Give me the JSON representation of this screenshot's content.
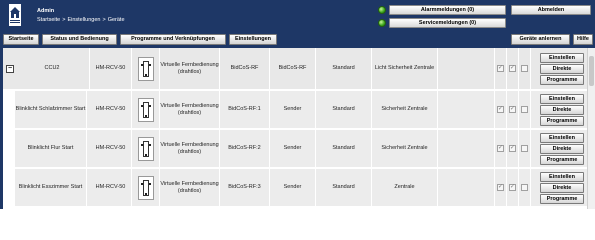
{
  "header": {
    "user": "Admin",
    "breadcrumb": [
      "Startseite",
      "Einstellungen",
      "Geräte"
    ],
    "breadcrumb_sep": ">",
    "alarm_button": "Alarmmeldungen (0)",
    "service_button": "Servicemeldungen (0)",
    "logout_button": "Abmelden"
  },
  "nav": {
    "home": "Startseite",
    "status": "Status und Bedienung",
    "programs": "Programme und Verknüpfungen",
    "settings": "Einstellungen",
    "teach": "Geräte anlernen",
    "help": "Hilfe"
  },
  "actions": {
    "settings": "Einstellen",
    "direct": "Direkte",
    "programs": "Programme"
  },
  "rows": [
    {
      "name": "CCU2",
      "type": "HM-RCV-50",
      "description": "Virtuelle Fernbedienung (drahtlos)",
      "address": "BidCoS-RF",
      "direction": "BidCoS-RF",
      "transfer": "Standard",
      "security": "Licht Sicherheit Zentrale",
      "expander": "−"
    },
    {
      "name": "Blinklicht Schlafzimmer Start",
      "type": "HM-RCV-50",
      "description": "Virtuelle Fernbedienung (drahtlos)",
      "address": "BidCoS-RF:1",
      "direction": "Sender",
      "transfer": "Standard",
      "security": "Sicherheit Zentrale"
    },
    {
      "name": "Blinklicht Flur Start",
      "type": "HM-RCV-50",
      "description": "Virtuelle Fernbedienung (drahtlos)",
      "address": "BidCoS-RF:2",
      "direction": "Sender",
      "transfer": "Standard",
      "security": "Sicherheit Zentrale"
    },
    {
      "name": "Blinklicht Esszimmer Start",
      "type": "HM-RCV-50",
      "description": "Virtuelle Fernbedienung (drahtlos)",
      "address": "BidCoS-RF:3",
      "direction": "Sender",
      "transfer": "Standard",
      "security": "Zentrale"
    }
  ],
  "colors": {
    "header_bg": "#1e3766",
    "row_bg": "#e8e8e8",
    "led_green": "#3aa61b"
  },
  "icons": {
    "logo": "house-icon",
    "led": "status-led-icon",
    "device": "remote-control-icon",
    "check": "checkbox-icon"
  }
}
